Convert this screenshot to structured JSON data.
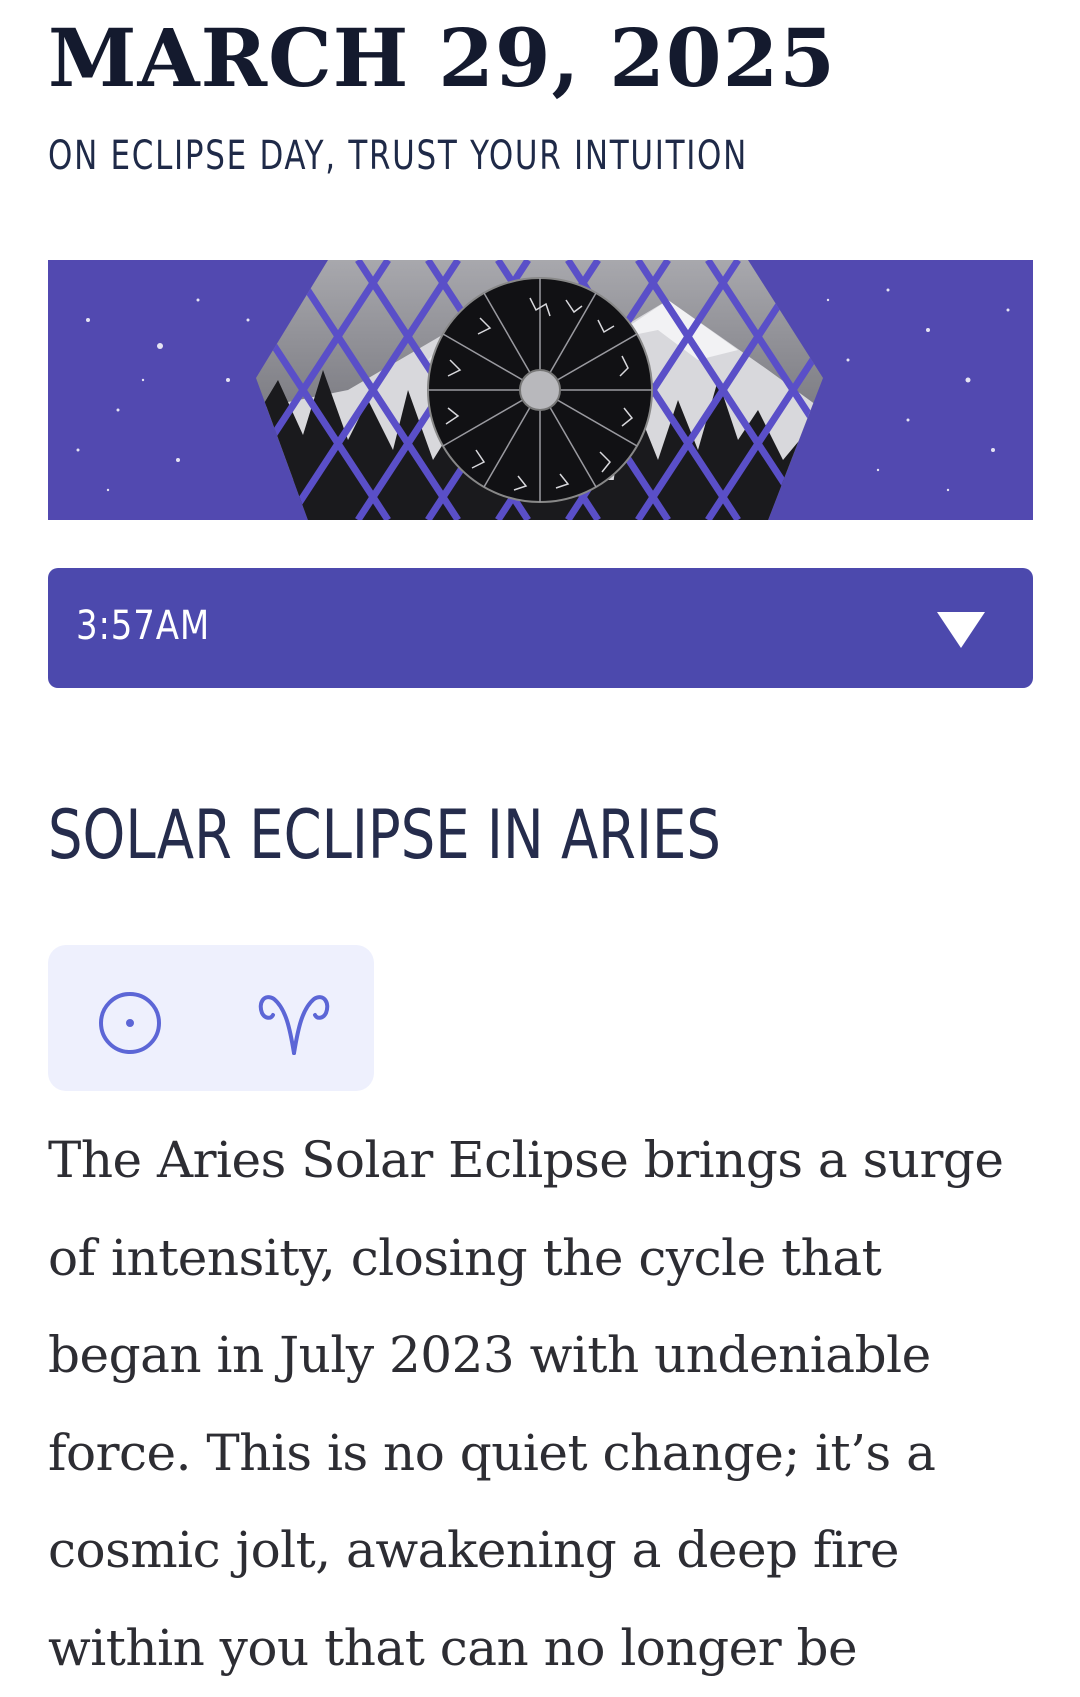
{
  "header": {
    "date": "MARCH 29, 2025",
    "subtitle": "ON ECLIPSE DAY, TRUST YOUR INTUITION"
  },
  "banner": {
    "icon": "zodiac-wheel-banner"
  },
  "time_select": {
    "value": "3:57AM",
    "icon": "triangle-down-icon"
  },
  "section": {
    "heading": "SOLAR ECLIPSE IN ARIES",
    "symbols": [
      "sun-symbol-icon",
      "aries-symbol-icon"
    ],
    "body": "The Aries Solar Eclipse brings a surge of intensity, closing the cycle that began in July 2023 with undeniable force. This is no quiet change; it’s a cosmic jolt, awakening a deep fire within you that can no longer be"
  },
  "colors": {
    "accent": "#4c49ad",
    "banner_bg": "#5249b0",
    "symbol_bg": "#eef0fd",
    "symbol_stroke": "#5c66d6",
    "heading": "#252c4c",
    "title": "#141a2e"
  }
}
